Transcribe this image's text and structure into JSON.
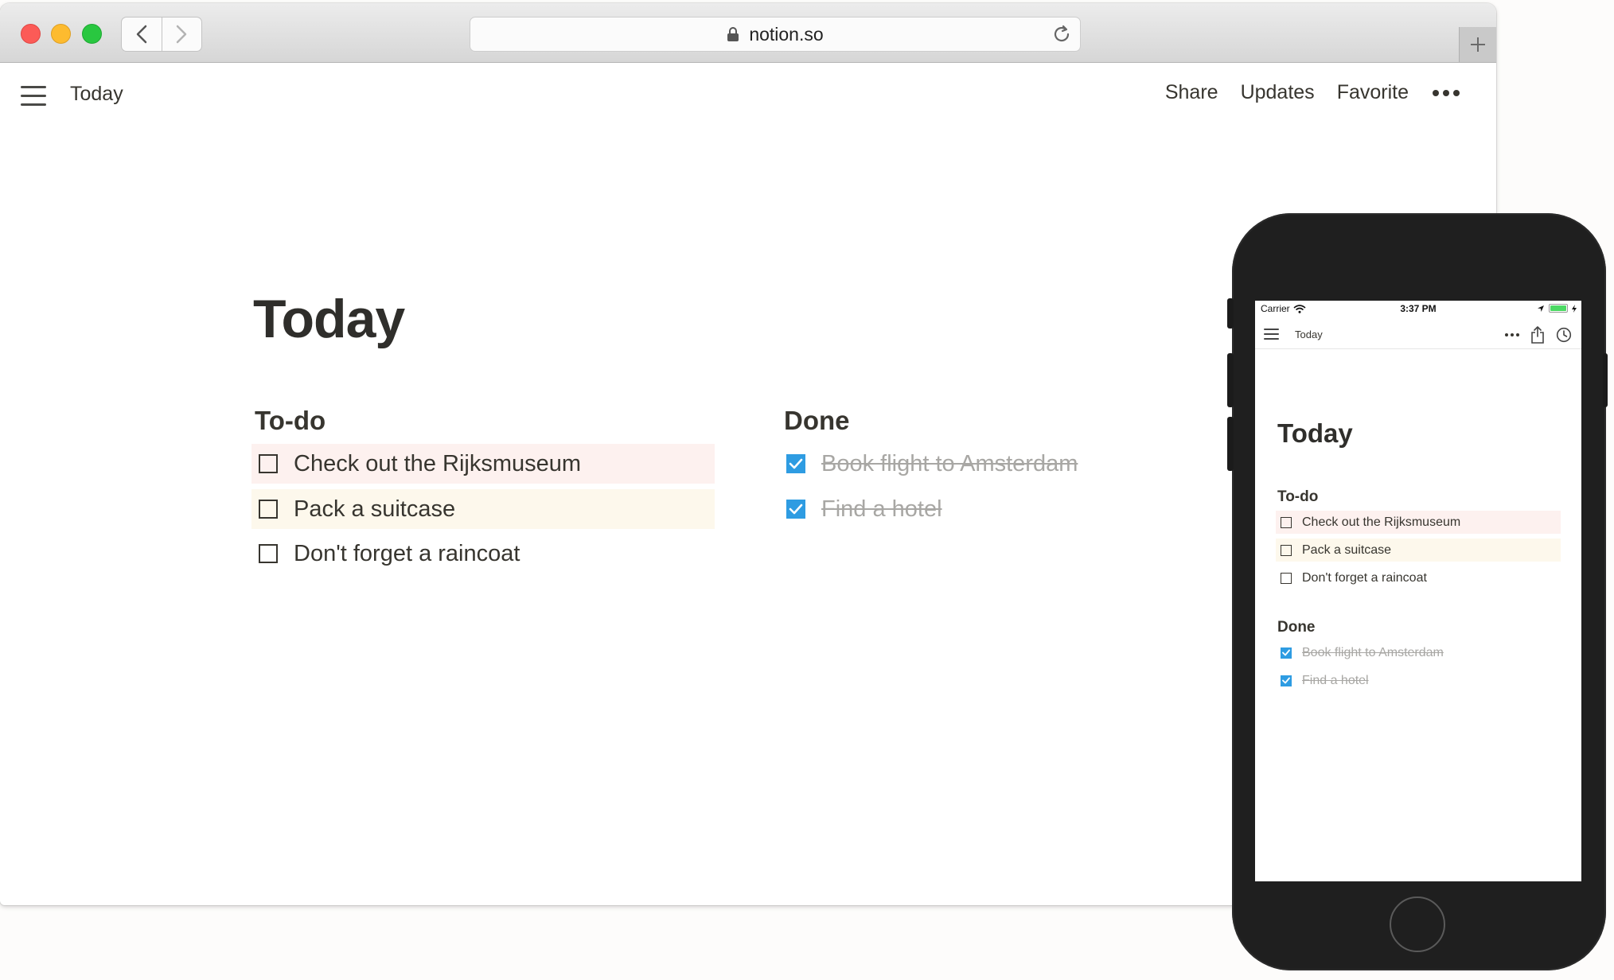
{
  "browser": {
    "url": "notion.so"
  },
  "topbar": {
    "breadcrumb": "Today",
    "share_label": "Share",
    "updates_label": "Updates",
    "favorite_label": "Favorite"
  },
  "page": {
    "title": "Today",
    "todo": {
      "heading": "To-do",
      "items": [
        {
          "label": "Check out the Rijksmuseum",
          "checked": false,
          "highlight": "red"
        },
        {
          "label": "Pack a suitcase",
          "checked": false,
          "highlight": "yellow"
        },
        {
          "label": "Don't forget a raincoat",
          "checked": false,
          "highlight": "none"
        }
      ]
    },
    "done": {
      "heading": "Done",
      "items": [
        {
          "label": "Book flight to Amsterdam",
          "checked": true
        },
        {
          "label": "Find a hotel",
          "checked": true
        }
      ]
    }
  },
  "phone": {
    "status": {
      "carrier": "Carrier",
      "time": "3:37 PM"
    },
    "breadcrumb": "Today",
    "title": "Today",
    "todo_heading": "To-do",
    "todo_items": [
      "Check out the Rijksmuseum",
      "Pack a suitcase",
      "Don't forget a raincoat"
    ],
    "done_heading": "Done",
    "done_items": [
      "Book flight to Amsterdam",
      "Find a hotel"
    ]
  },
  "colors": {
    "checkbox_checked": "#2e9ce2",
    "highlight_red": "#fdf1ef",
    "highlight_yellow": "#fdf8ec",
    "text": "#37352f",
    "done_text": "#a8a7a4"
  }
}
